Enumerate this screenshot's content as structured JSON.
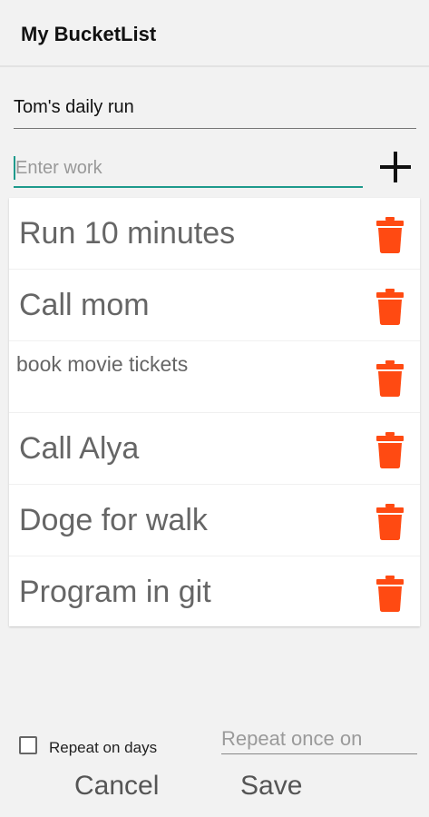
{
  "app": {
    "title": "My BucketList"
  },
  "form": {
    "title_value": "Tom's daily run",
    "work_placeholder": "Enter work",
    "add_icon": "plus-icon"
  },
  "items": [
    {
      "label": "Run 10 minutes",
      "delete_icon": "trash-icon"
    },
    {
      "label": "Call mom",
      "delete_icon": "trash-icon"
    },
    {
      "label": "book movie tickets",
      "delete_icon": "trash-icon"
    },
    {
      "label": "Call Alya",
      "delete_icon": "trash-icon"
    },
    {
      "label": "Doge for walk",
      "delete_icon": "trash-icon"
    },
    {
      "label": "Program in git",
      "delete_icon": "trash-icon"
    }
  ],
  "footer": {
    "repeat_days_label": "Repeat on days",
    "repeat_days_checked": false,
    "repeat_once_placeholder": "Repeat once on",
    "cancel_label": "Cancel",
    "save_label": "Save"
  },
  "colors": {
    "accent": "#1e9a8c",
    "delete": "#ff4a12"
  }
}
